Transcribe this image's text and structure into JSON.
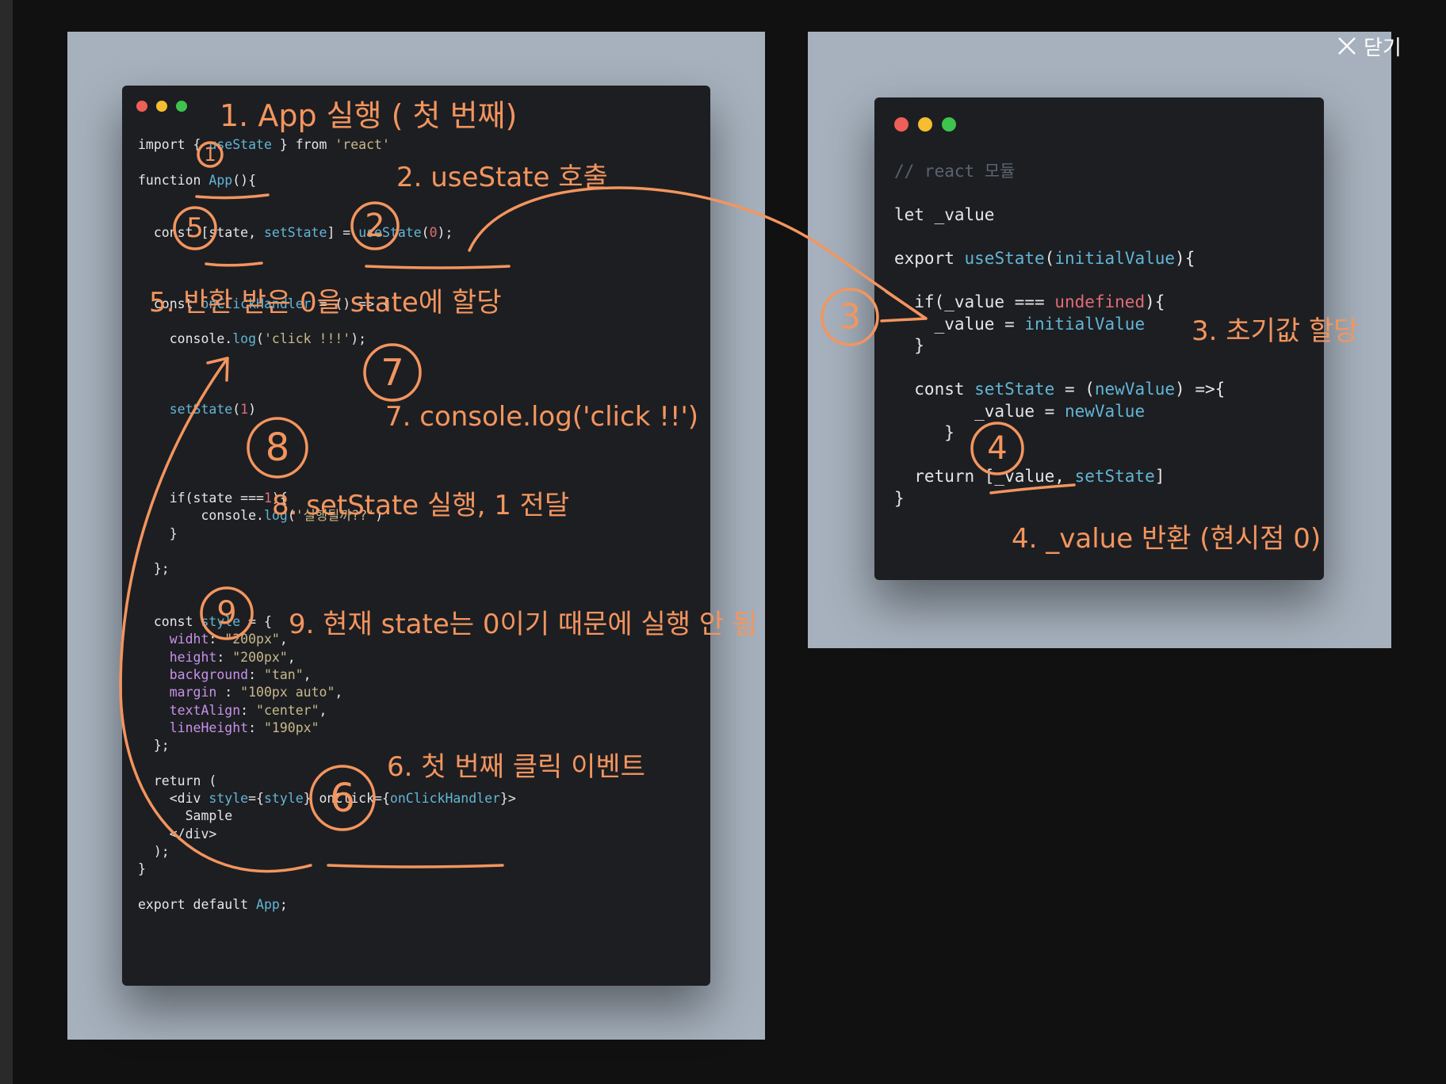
{
  "close_button": {
    "label": "닫기",
    "icon": "close-icon"
  },
  "left_window": {
    "traffic_lights": [
      "#ee5f57",
      "#f5bd2f",
      "#3fc34f"
    ],
    "code_lines": [
      "import { useState } from 'react'",
      "",
      "function App(){",
      "",
      "",
      "  const [state, setState] = useState(0);",
      "",
      "",
      "",
      "  const onClickHandler = () => {",
      "",
      "    console.log('click !!!');",
      "",
      "",
      "",
      "    setState(1)",
      "",
      "",
      "",
      "",
      "    if(state ===1){",
      "        console.log('실행될까??')",
      "    }",
      "",
      "  };",
      "",
      "",
      "  const style = {",
      "    widht: \"200px\",",
      "    height: \"200px\",",
      "    background: \"tan\",",
      "    margin : \"100px auto\",",
      "    textAlign: \"center\",",
      "    lineHeight: \"190px\"",
      "  };",
      "",
      "  return (",
      "    <div style={style} onClick={onClickHandler}>",
      "      Sample",
      "    </div>",
      "  );",
      "}",
      "",
      "export default App;"
    ]
  },
  "right_window": {
    "traffic_lights": [
      "#ee5f57",
      "#f5bd2f",
      "#3fc34f"
    ],
    "code_lines": [
      "// react 모듈",
      "",
      "let _value",
      "",
      "export useState(initialValue){",
      "",
      "  if(_value === undefined){",
      "    _value = initialValue",
      "  }",
      "",
      "  const setState = (newValue) =>{",
      "        _value = newValue",
      "     }",
      "",
      "  return [_value, setState]",
      "}"
    ]
  },
  "annotations": {
    "step1": "1. App 실행 ( 첫 번째)",
    "step2": "2. useState 호출",
    "step3": "3. 초기값 할당",
    "step4": "4. _value 반환 (현시점 0)",
    "step5": "5. 반환 받은 0을 state에 할당",
    "step6": "6. 첫 번째 클릭 이벤트",
    "step7": "7. console.log('click !!')",
    "step8": "8. setState 실행, 1 전달",
    "step9": "9. 현재 state는 0이기 때문에 실행 안 됨"
  },
  "circled_numbers": [
    "1",
    "2",
    "3",
    "4",
    "5",
    "6",
    "7",
    "8",
    "9"
  ],
  "annotation_color": "#f3955e",
  "panel_color": "#a6b1bd",
  "code_bg": "#1d1e22"
}
